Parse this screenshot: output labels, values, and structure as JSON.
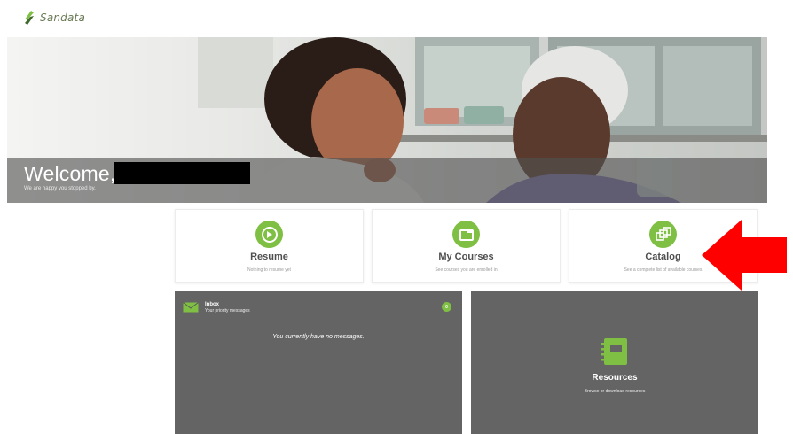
{
  "brand": {
    "name": "Sandata",
    "accent": "#7fbf43"
  },
  "hero": {
    "welcome": "Welcome,",
    "subtitle": "We are happy you stopped by."
  },
  "cards": [
    {
      "title": "Resume",
      "subtitle": "Nothing to resume yet",
      "icon": "arrow-circle-icon"
    },
    {
      "title": "My Courses",
      "subtitle": "See courses you are enrolled in",
      "icon": "courses-icon"
    },
    {
      "title": "Catalog",
      "subtitle": "See a complete list of available courses",
      "icon": "catalog-icon"
    }
  ],
  "inbox": {
    "title": "Inbox",
    "subtitle": "Your priority messages",
    "count": "0",
    "empty": "You currently have no messages."
  },
  "resources": {
    "title": "Resources",
    "subtitle": "Browse or download resources"
  },
  "annotation": {
    "arrow_color": "#ff0000"
  }
}
